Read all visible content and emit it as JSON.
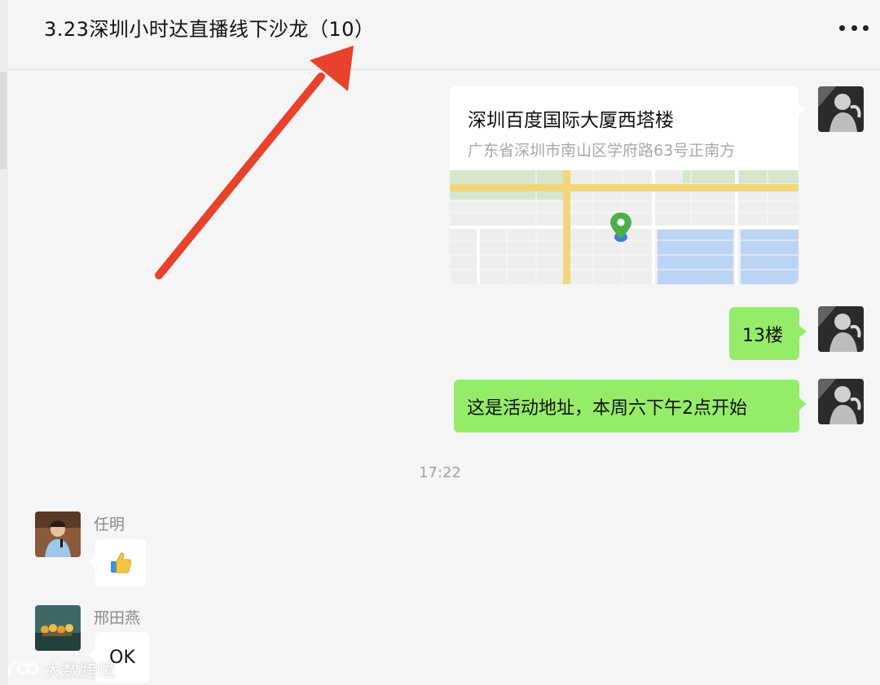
{
  "header": {
    "title": "3.23深圳小时达直播线下沙龙（10）",
    "more_icon": "more-dots-icon"
  },
  "messages": {
    "location": {
      "name": "深圳百度国际大厦西塔楼",
      "address": "广东省深圳市南山区学府路63号正南方",
      "pin_icon": "map-pin-icon"
    },
    "floor_text": "13楼",
    "address_note": "这是活动地址，本周六下午2点开始",
    "timestamp": "17:22",
    "received": [
      {
        "sender": "任明",
        "content_icon": "thumbs-up-emoji"
      },
      {
        "sender": "邢田燕",
        "text": "OK"
      }
    ]
  },
  "annotation": {
    "arrow_color": "#e8412c",
    "arrow_icon": "red-arrow-icon"
  },
  "watermark": {
    "text": "大数跨境",
    "logo_icon": "watermark-logo-icon"
  },
  "colors": {
    "green_bubble": "#95ec69",
    "background": "#f5f5f5",
    "map_road_yellow": "#f2d67a",
    "map_water": "#bcd4f4",
    "pin_green": "#4cae4c"
  }
}
